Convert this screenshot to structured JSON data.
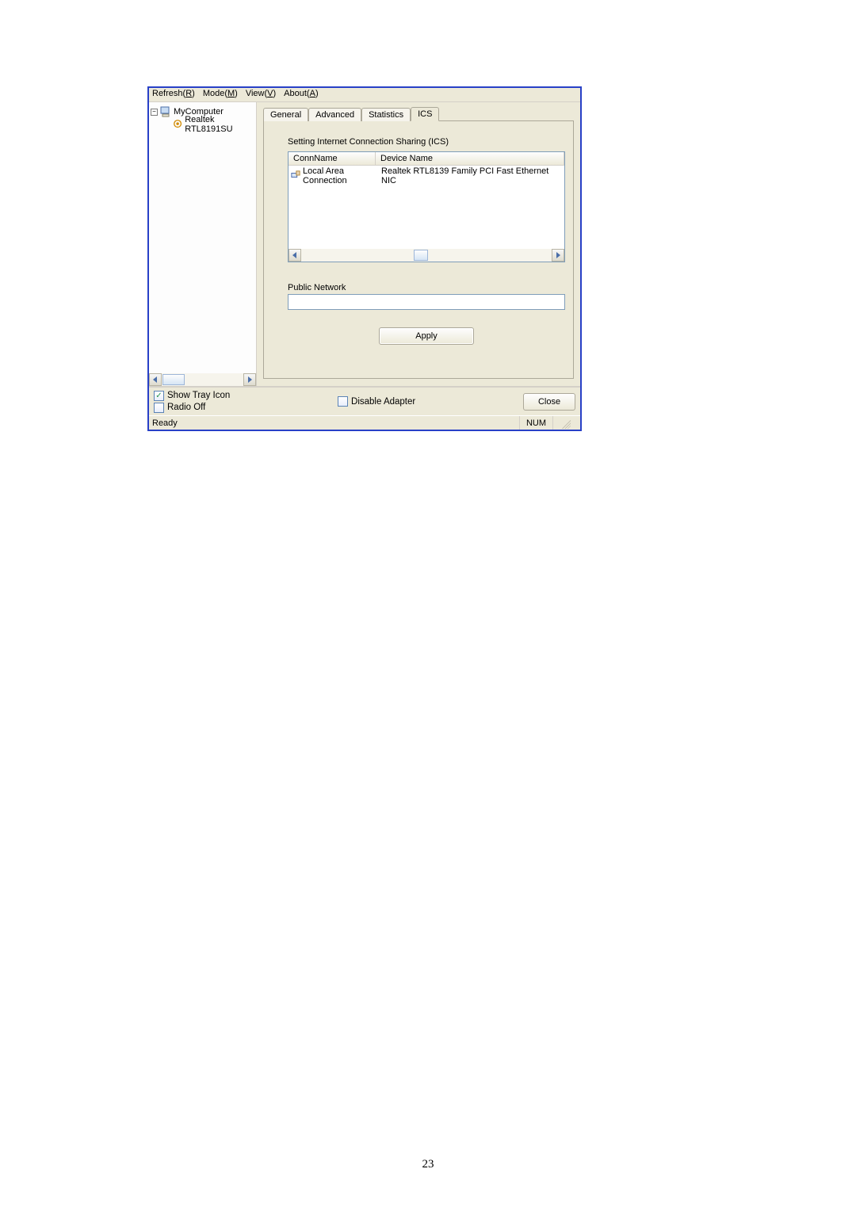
{
  "menubar": {
    "refresh": "Refresh(",
    "refresh_u": "R",
    "refresh_end": ")",
    "mode": "Mode(",
    "mode_u": "M",
    "mode_end": ")",
    "view": "View(",
    "view_u": "V",
    "view_end": ")",
    "about": "About(",
    "about_u": "A",
    "about_end": ")"
  },
  "tree": {
    "root": "MyComputer",
    "child": "Realtek RTL8191SU "
  },
  "tabs": {
    "general": "General",
    "advanced": "Advanced",
    "statistics": "Statistics",
    "ics": "ICS"
  },
  "ics": {
    "section_title": "Setting Internet Connection Sharing (ICS)",
    "col_conn": "ConnName",
    "col_dev": "Device Name",
    "row_conn": "Local Area Connection",
    "row_dev": "Realtek RTL8139 Family PCI Fast Ethernet NIC",
    "public_label": "Public Network",
    "apply": "Apply"
  },
  "bottom": {
    "show_tray": "Show Tray Icon",
    "radio_off": "Radio Off",
    "disable_adapter": "Disable Adapter",
    "close": "Close"
  },
  "statusbar": {
    "ready": "Ready",
    "num": "NUM"
  },
  "pagenum": "23"
}
